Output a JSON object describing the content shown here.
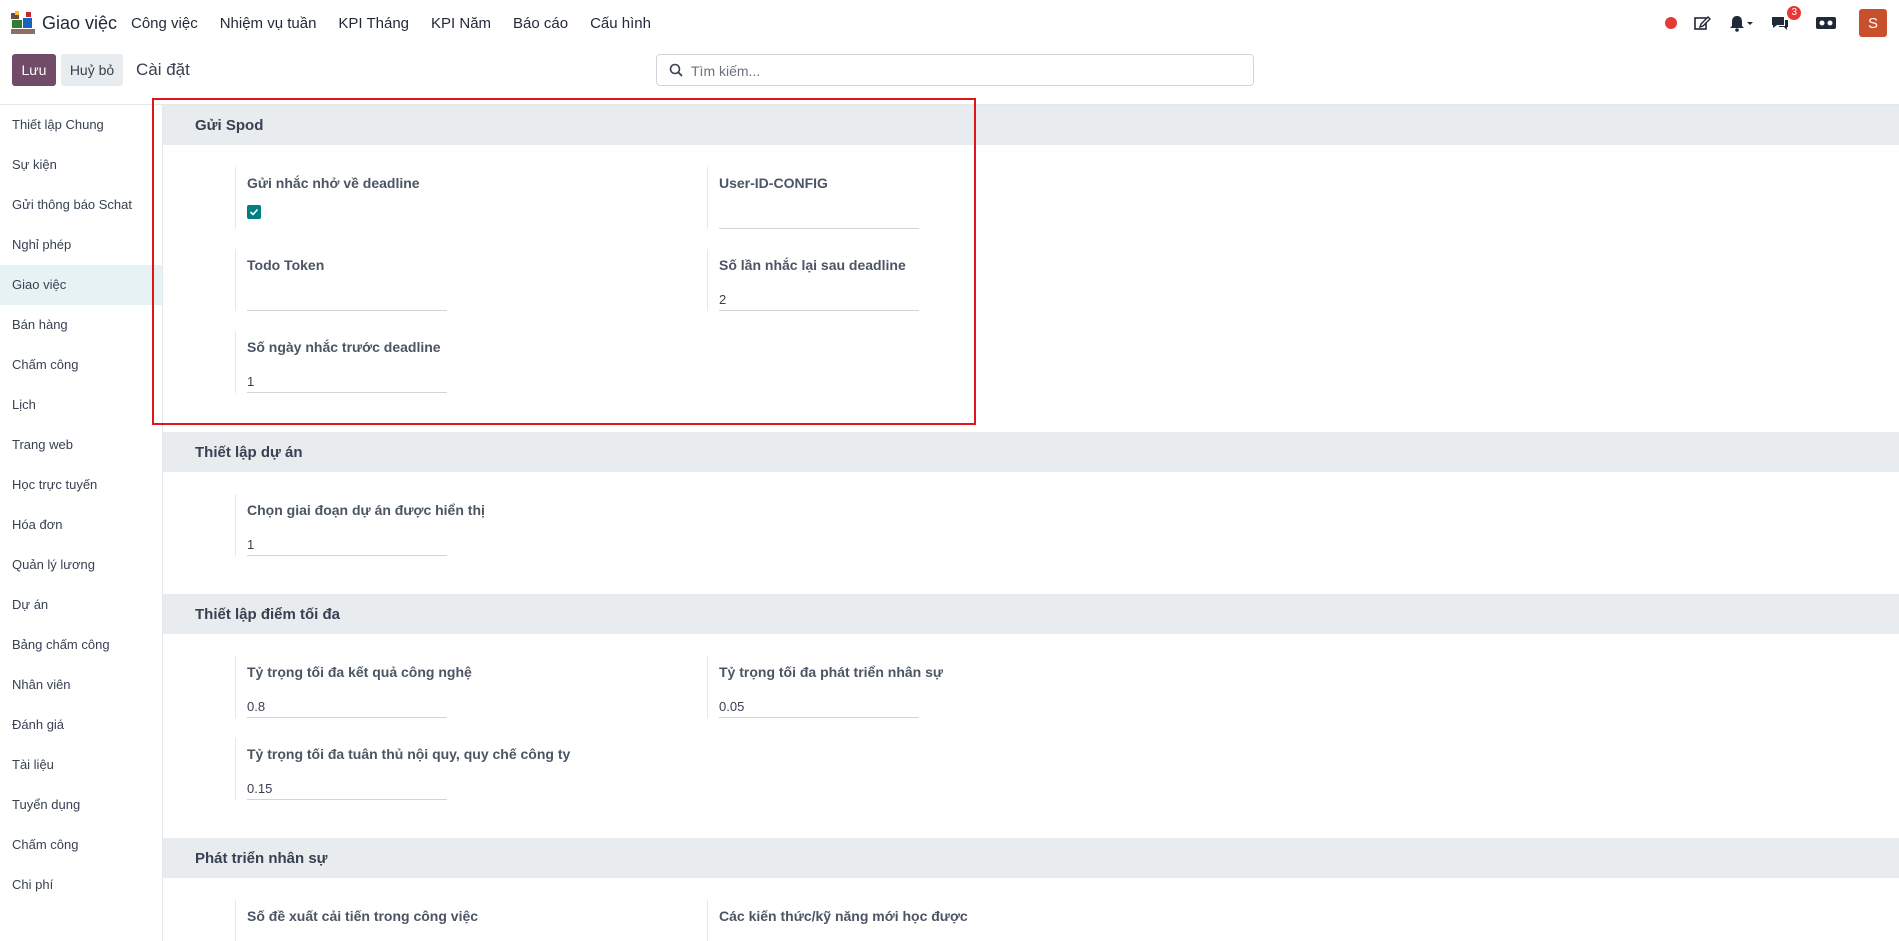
{
  "navbar": {
    "app_name": "Giao việc",
    "menu": [
      "Công việc",
      "Nhiệm vụ tuần",
      "KPI Tháng",
      "KPI Năm",
      "Báo cáo",
      "Cấu hình"
    ],
    "messages_count": "3",
    "avatar_letter": "S"
  },
  "control": {
    "save_label": "Lưu",
    "discard_label": "Huỷ bỏ",
    "title": "Cài đặt",
    "search_placeholder": "Tìm kiếm..."
  },
  "sidebar": {
    "items": [
      "Thiết lập Chung",
      "Sự kiện",
      "Gửi thông báo Schat",
      "Nghỉ phép",
      "Giao việc",
      "Bán hàng",
      "Chấm công",
      "Lịch",
      "Trang web",
      "Học trực tuyến",
      "Hóa đơn",
      "Quản lý lương",
      "Dự án",
      "Bảng chấm công",
      "Nhân viên",
      "Đánh giá",
      "Tài liệu",
      "Tuyển dụng",
      "Chấm công",
      "Chi phí"
    ],
    "active": "Giao việc"
  },
  "sections": {
    "spod": {
      "title": "Gửi Spod",
      "reminder_label": "Gửi nhắc nhở về deadline",
      "reminder_checked": true,
      "user_id_label": "User-ID-CONFIG",
      "user_id_value": "",
      "todo_token_label": "Todo Token",
      "todo_token_value": "",
      "repeat_label": "Số lần nhắc lại sau deadline",
      "repeat_value": "2",
      "days_before_label": "Số ngày nhắc trước deadline",
      "days_before_value": "1"
    },
    "project": {
      "title": "Thiết lập dự án",
      "stage_label": "Chọn giai đoạn dự án được hiển thị",
      "stage_value": "1"
    },
    "max_score": {
      "title": "Thiết lập điểm tối đa",
      "tech_label": "Tỷ trọng tối đa kết quả công nghệ",
      "tech_value": "0.8",
      "hr_label": "Tỷ trọng tối đa phát triển nhân sự",
      "hr_value": "0.05",
      "rules_label": "Tỷ trọng tối đa tuân thủ nội quy, quy chế công ty",
      "rules_value": "0.15"
    },
    "hr_dev": {
      "title": "Phát triển nhân sự",
      "improve_label": "Số đề xuất cải tiến trong công việc",
      "skills_label": "Các kiến thức/kỹ năng mới học được"
    }
  }
}
